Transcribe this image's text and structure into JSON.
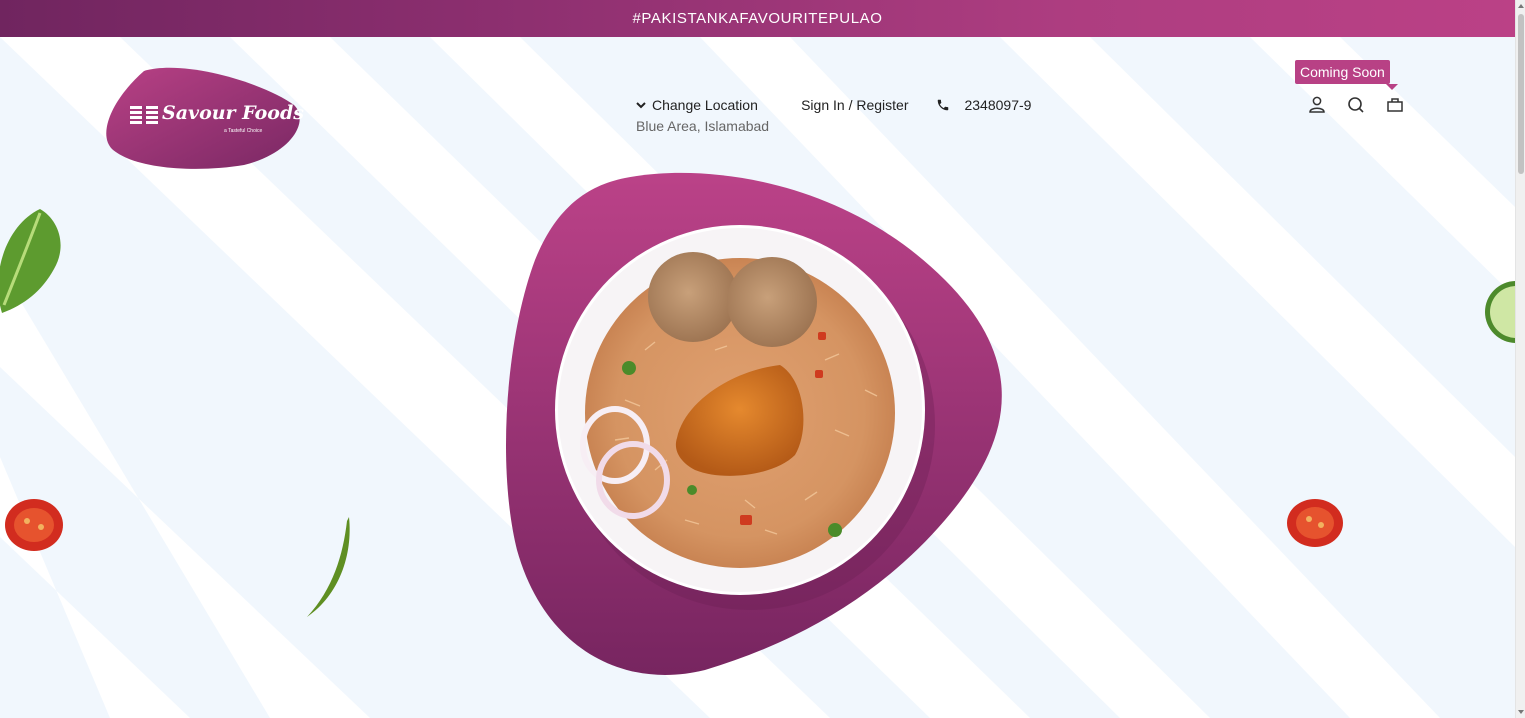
{
  "promo_banner": {
    "text": "#PAKISTANKAFAVOURITEPULAO"
  },
  "brand": {
    "name": "Savour Foods",
    "tagline": "a Tasteful Choice"
  },
  "location": {
    "label": "Change Location",
    "current": "Blue Area, Islamabad"
  },
  "auth": {
    "label": "Sign In / Register"
  },
  "contact": {
    "phone": "2348097-9"
  },
  "header_icons": {
    "tooltip": "Coming Soon",
    "account": "user-icon",
    "search": "search-icon",
    "cart": "cart-icon"
  },
  "hero": {
    "image": "chicken-pulao-plate"
  },
  "decorations": [
    "lettuce-leaf",
    "tomato-left",
    "green-chili",
    "tomato-right",
    "cucumber-slice"
  ],
  "colors": {
    "brand": "#b84185",
    "brand_dark": "#70255f",
    "background": "#f1f7fd"
  }
}
